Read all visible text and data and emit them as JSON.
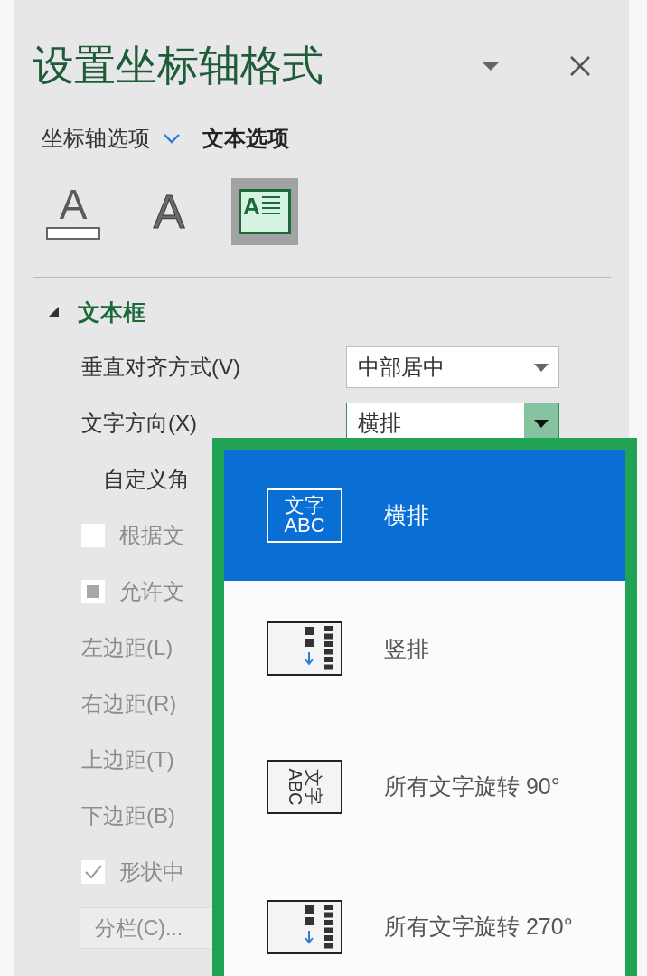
{
  "panel": {
    "title": "设置坐标轴格式"
  },
  "tabs": [
    {
      "label": "坐标轴选项",
      "selected": false,
      "has_menu": true
    },
    {
      "label": "文本选项",
      "selected": true,
      "has_menu": false
    }
  ],
  "icon_tabs": [
    {
      "kind": "fill",
      "glyph": "A",
      "selected": false
    },
    {
      "kind": "outline",
      "glyph": "A",
      "selected": false
    },
    {
      "kind": "textbox",
      "glyph": "A",
      "selected": true
    }
  ],
  "section": {
    "title": "文本框",
    "expanded": true
  },
  "rows": [
    {
      "kind": "select",
      "label": "垂直对齐方式(V)",
      "value": "中部居中",
      "open": false,
      "disabled": false
    },
    {
      "kind": "select",
      "label": "文字方向(X)",
      "value": "横排",
      "open": true,
      "disabled": false
    },
    {
      "kind": "label",
      "label": "自定义角",
      "disabled": false
    },
    {
      "kind": "checkbox",
      "label": "根据文",
      "checked": false,
      "mixed": false,
      "disabled": true
    },
    {
      "kind": "checkbox",
      "label": "允许文",
      "checked": false,
      "mixed": true,
      "disabled": true
    },
    {
      "kind": "label",
      "label": "左边距(L)",
      "disabled": true
    },
    {
      "kind": "label",
      "label": "右边距(R)",
      "disabled": true
    },
    {
      "kind": "label",
      "label": "上边距(T)",
      "disabled": true
    },
    {
      "kind": "label",
      "label": "下边距(B)",
      "disabled": true
    },
    {
      "kind": "checkbox",
      "label": "形状中",
      "checked": true,
      "mixed": false,
      "disabled": true
    },
    {
      "kind": "button",
      "label": "分栏(C)...",
      "disabled": true
    }
  ],
  "dropdown": {
    "options": [
      {
        "kind": "horizontal",
        "icon_text": [
          "文字",
          "ABC"
        ],
        "label": "横排",
        "selected": true
      },
      {
        "kind": "vertical",
        "label": "竖排",
        "selected": false
      },
      {
        "kind": "rotate90",
        "icon_text": [
          "文字",
          "ABC"
        ],
        "label": "所有文字旋转 90°",
        "selected": false
      },
      {
        "kind": "rotate270",
        "label": "所有文字旋转 270°",
        "selected": false
      }
    ]
  }
}
